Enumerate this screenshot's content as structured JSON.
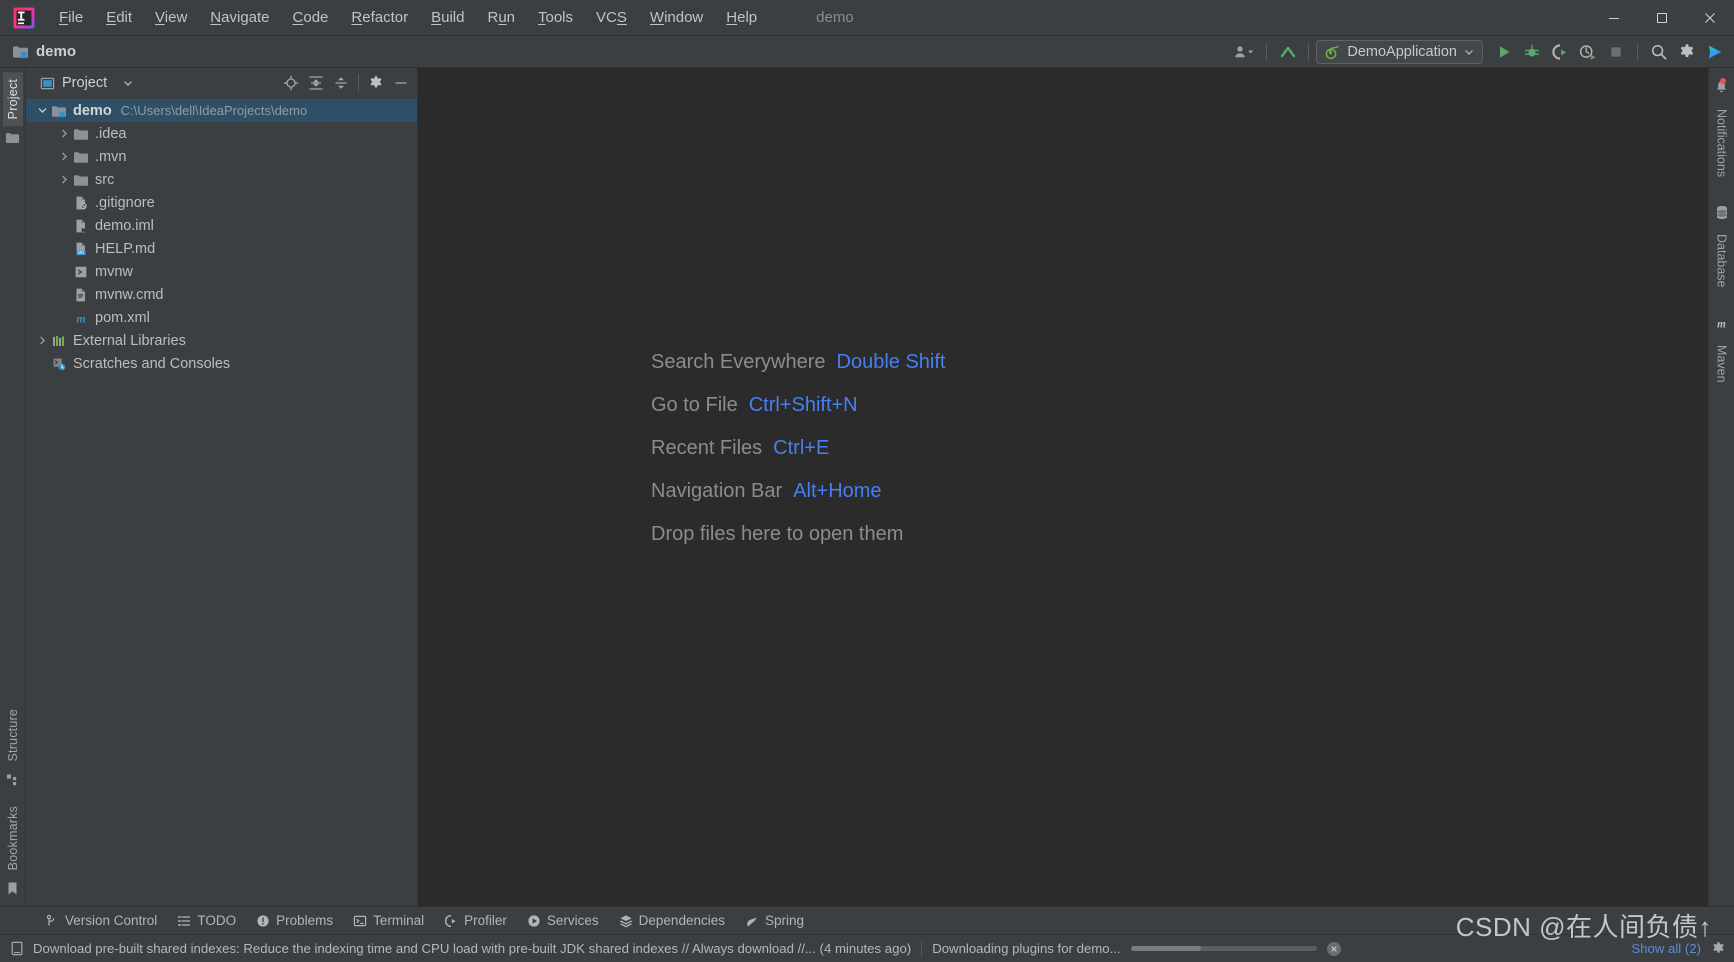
{
  "window": {
    "app_title": "demo",
    "minimize_label": "Minimize",
    "maximize_label": "Maximize",
    "close_label": "Close"
  },
  "menubar": {
    "items": [
      {
        "label": "File",
        "mnemonic": "F"
      },
      {
        "label": "Edit",
        "mnemonic": "E"
      },
      {
        "label": "View",
        "mnemonic": "V"
      },
      {
        "label": "Navigate",
        "mnemonic": "N"
      },
      {
        "label": "Code",
        "mnemonic": "C"
      },
      {
        "label": "Refactor",
        "mnemonic": "R"
      },
      {
        "label": "Build",
        "mnemonic": "B"
      },
      {
        "label": "Run",
        "mnemonic": "u"
      },
      {
        "label": "Tools",
        "mnemonic": "T"
      },
      {
        "label": "VCS",
        "mnemonic": "S"
      },
      {
        "label": "Window",
        "mnemonic": "W"
      },
      {
        "label": "Help",
        "mnemonic": "H"
      }
    ]
  },
  "toolbar": {
    "breadcrumb": "demo",
    "run_configuration": "DemoApplication",
    "icons": {
      "account": "account-icon",
      "updates": "updates-icon",
      "run": "run-icon",
      "debug": "debug-icon",
      "run_with_coverage": "run-with-coverage-icon",
      "profile": "profile-icon",
      "stop": "stop-icon",
      "search": "search-icon",
      "settings": "settings-icon",
      "ide_services": "ide-services-icon"
    }
  },
  "left_stripe": {
    "top": [
      {
        "label": "Project",
        "active": true
      }
    ],
    "bottom": [
      {
        "label": "Structure",
        "active": false
      },
      {
        "label": "Bookmarks",
        "active": false
      }
    ]
  },
  "right_stripe": {
    "items": [
      {
        "label": "Notifications",
        "badge": true
      },
      {
        "label": "Database",
        "badge": false
      },
      {
        "label": "Maven",
        "badge": false
      }
    ]
  },
  "project_panel": {
    "title": "Project",
    "actions": [
      "locate-icon",
      "expand-all-icon",
      "collapse-all-icon",
      "settings-icon",
      "hide-icon"
    ],
    "tree": [
      {
        "label": "demo",
        "path": "C:\\Users\\dell\\IdeaProjects\\demo",
        "icon": "module-folder-icon",
        "depth": 0,
        "arrow": "expanded",
        "selected": true,
        "bold": true
      },
      {
        "label": ".idea",
        "path": "",
        "icon": "folder-icon",
        "depth": 1,
        "arrow": "collapsed",
        "selected": false,
        "bold": false
      },
      {
        "label": ".mvn",
        "path": "",
        "icon": "folder-icon",
        "depth": 1,
        "arrow": "collapsed",
        "selected": false,
        "bold": false
      },
      {
        "label": "src",
        "path": "",
        "icon": "folder-icon",
        "depth": 1,
        "arrow": "collapsed",
        "selected": false,
        "bold": false
      },
      {
        "label": ".gitignore",
        "path": "",
        "icon": "gitignore-file-icon",
        "depth": 1,
        "arrow": "none",
        "selected": false,
        "bold": false
      },
      {
        "label": "demo.iml",
        "path": "",
        "icon": "iml-file-icon",
        "depth": 1,
        "arrow": "none",
        "selected": false,
        "bold": false
      },
      {
        "label": "HELP.md",
        "path": "",
        "icon": "markdown-file-icon",
        "depth": 1,
        "arrow": "none",
        "selected": false,
        "bold": false
      },
      {
        "label": "mvnw",
        "path": "",
        "icon": "script-file-icon",
        "depth": 1,
        "arrow": "none",
        "selected": false,
        "bold": false
      },
      {
        "label": "mvnw.cmd",
        "path": "",
        "icon": "cmd-file-icon",
        "depth": 1,
        "arrow": "none",
        "selected": false,
        "bold": false
      },
      {
        "label": "pom.xml",
        "path": "",
        "icon": "maven-pom-icon",
        "depth": 1,
        "arrow": "none",
        "selected": false,
        "bold": false
      },
      {
        "label": "External Libraries",
        "path": "",
        "icon": "libraries-icon",
        "depth": 0,
        "arrow": "collapsed",
        "selected": false,
        "bold": false
      },
      {
        "label": "Scratches and Consoles",
        "path": "",
        "icon": "scratches-icon",
        "depth": 0,
        "arrow": "none",
        "selected": false,
        "bold": false
      }
    ]
  },
  "editor": {
    "hints": [
      {
        "label": "Search Everywhere",
        "key": "Double Shift"
      },
      {
        "label": "Go to File",
        "key": "Ctrl+Shift+N"
      },
      {
        "label": "Recent Files",
        "key": "Ctrl+E"
      },
      {
        "label": "Navigation Bar",
        "key": "Alt+Home"
      },
      {
        "label": "Drop files here to open them",
        "key": ""
      }
    ]
  },
  "tool_window_bar": {
    "items": [
      {
        "label": "Version Control",
        "icon": "vcs-branch-icon"
      },
      {
        "label": "TODO",
        "icon": "todo-list-icon"
      },
      {
        "label": "Problems",
        "icon": "problems-icon"
      },
      {
        "label": "Terminal",
        "icon": "terminal-icon"
      },
      {
        "label": "Profiler",
        "icon": "profiler-icon"
      },
      {
        "label": "Services",
        "icon": "services-icon"
      },
      {
        "label": "Dependencies",
        "icon": "dependencies-icon"
      },
      {
        "label": "Spring",
        "icon": "spring-leaf-icon"
      }
    ]
  },
  "statusbar": {
    "message": "Download pre-built shared indexes: Reduce the indexing time and CPU load with pre-built JDK shared indexes // Always download //... (4 minutes ago)",
    "progress_label": "Downloading plugins for demo...",
    "progress_percent": 38,
    "show_all_label": "Show all (2)",
    "watermark": "CSDN @在人间负债↑"
  },
  "colors": {
    "accent_blue": "#467ff2",
    "selection": "#2f4f66",
    "editor_bg": "#2b2b2b",
    "chrome_bg": "#3c3f41",
    "run_green": "#59a869",
    "badge_red": "#e05555"
  }
}
